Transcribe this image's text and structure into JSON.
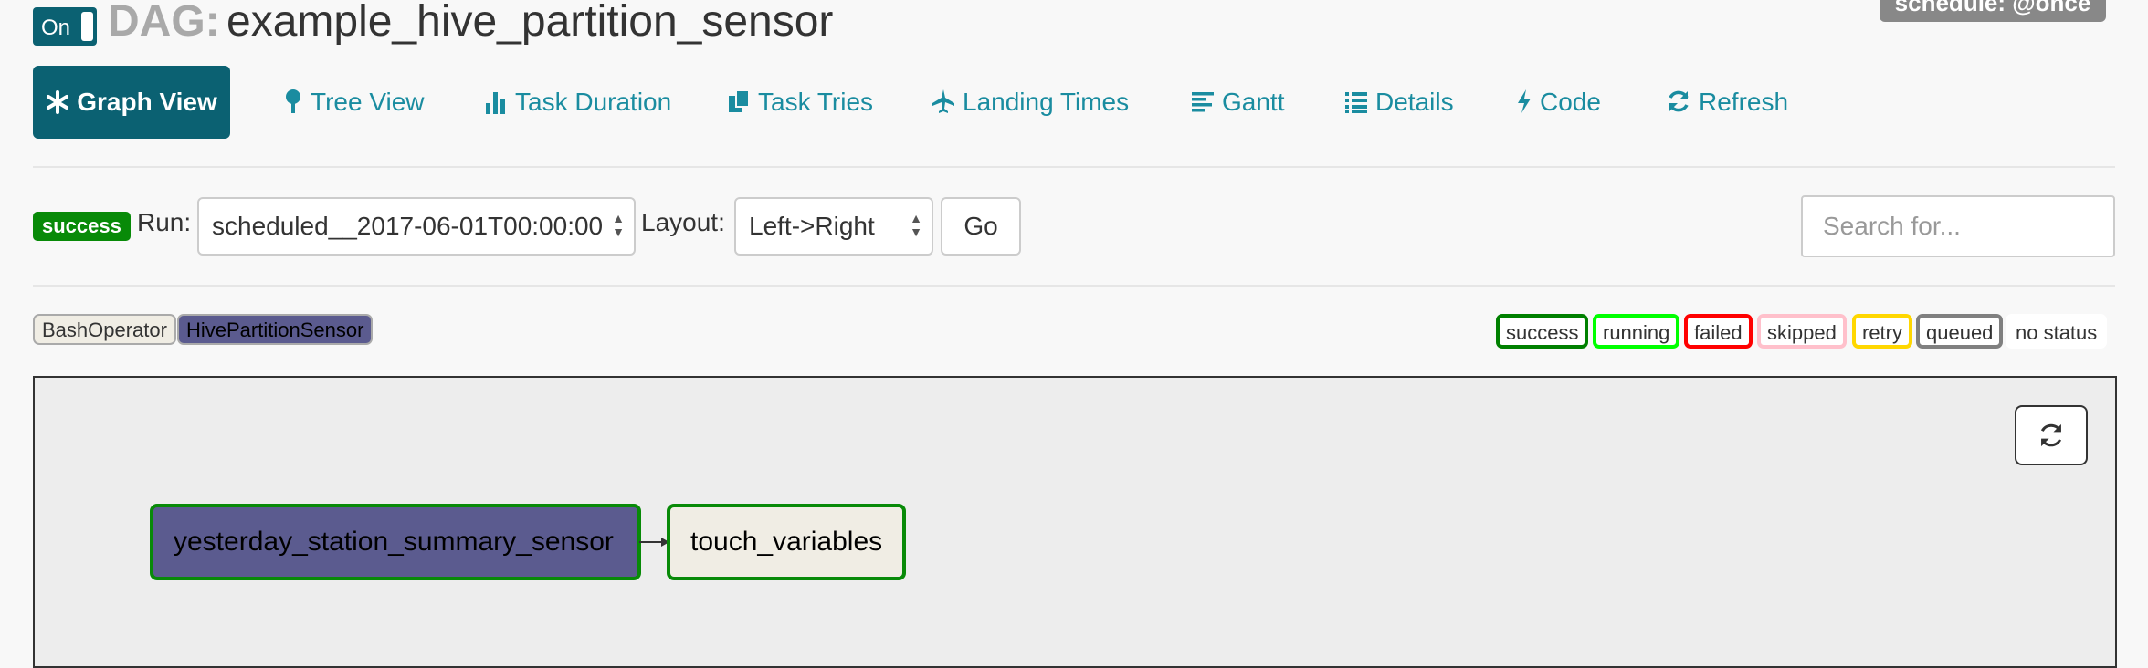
{
  "header": {
    "toggle_label": "On",
    "dag_prefix": "DAG:",
    "dag_id": "example_hive_partition_sensor",
    "schedule": "schedule: @once"
  },
  "tabs": [
    {
      "label": "Graph View",
      "icon": "asterisk-icon",
      "active": true
    },
    {
      "label": "Tree View",
      "icon": "tree-icon"
    },
    {
      "label": "Task Duration",
      "icon": "bar-chart-icon"
    },
    {
      "label": "Task Tries",
      "icon": "duplicate-icon"
    },
    {
      "label": "Landing Times",
      "icon": "plane-icon"
    },
    {
      "label": "Gantt",
      "icon": "align-left-icon"
    },
    {
      "label": "Details",
      "icon": "list-icon"
    },
    {
      "label": "Code",
      "icon": "flash-icon"
    },
    {
      "label": "Refresh",
      "icon": "refresh-icon"
    }
  ],
  "controls": {
    "state_badge": "success",
    "run_label": "Run:",
    "run_value": "scheduled__2017-06-01T00:00:00",
    "layout_label": "Layout:",
    "layout_value": "Left->Right",
    "go_label": "Go",
    "search_placeholder": "Search for..."
  },
  "operators": [
    {
      "label": "BashOperator",
      "color": "#f0ede4"
    },
    {
      "label": "HivePartitionSensor",
      "color": "#5b5b8f"
    }
  ],
  "states": [
    {
      "label": "success",
      "color": "#008000"
    },
    {
      "label": "running",
      "color": "#00ff00"
    },
    {
      "label": "failed",
      "color": "#ff0000"
    },
    {
      "label": "skipped",
      "color": "#ffc0cb"
    },
    {
      "label": "retry",
      "color": "#ffd700"
    },
    {
      "label": "queued",
      "color": "#808080"
    },
    {
      "label": "no status",
      "color": "#ffffff"
    }
  ],
  "graph": {
    "nodes": [
      {
        "label": "yesterday_station_summary_sensor",
        "operator": "HivePartitionSensor",
        "state": "success"
      },
      {
        "label": "touch_variables",
        "operator": "BashOperator",
        "state": "success"
      }
    ],
    "edges": [
      [
        "yesterday_station_summary_sensor",
        "touch_variables"
      ]
    ]
  }
}
